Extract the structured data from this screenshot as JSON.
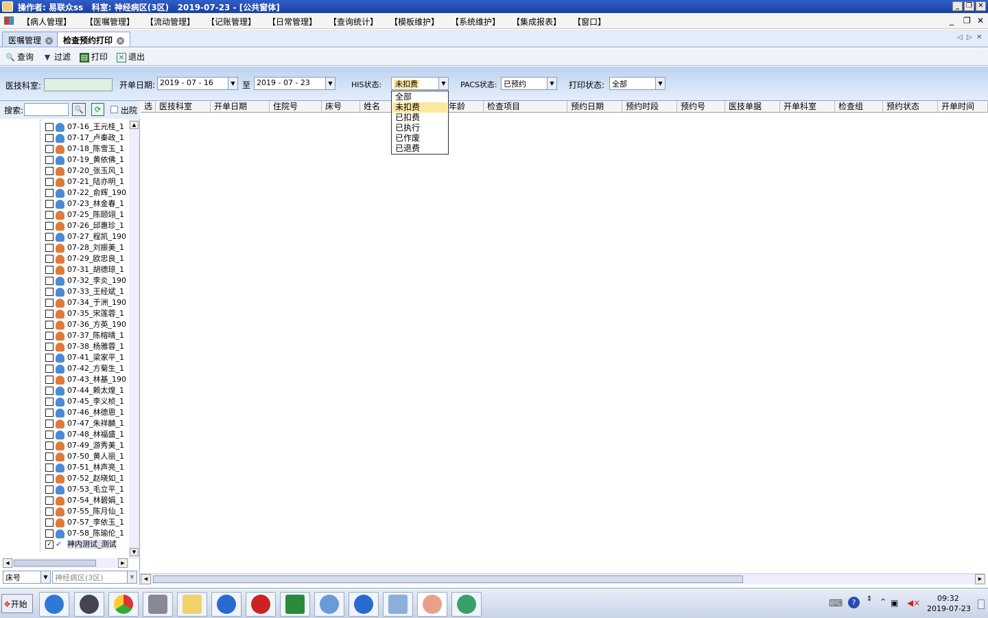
{
  "window": {
    "title": "操作者: 易联众ss   科室: 神经病区(3区)   2019-07-23 - [公共窗体]",
    "buttons": [
      "_",
      "❐",
      "✕"
    ]
  },
  "menu": {
    "items": [
      "【病人管理】",
      "【医嘱管理】",
      "【流动管理】",
      "【记账管理】",
      "【日常管理】",
      "【查询统计】",
      "【模板维护】",
      "【系统维护】",
      "【集成报表】",
      "【窗口】"
    ],
    "right_buttons": [
      "_",
      "❐",
      "✕"
    ]
  },
  "tabs": [
    {
      "label": "医嘱管理",
      "active": false
    },
    {
      "label": "检查预约打印",
      "active": true
    }
  ],
  "tab_nav": [
    "◁",
    "▷",
    "✕"
  ],
  "toolbar": {
    "query": "查询",
    "filter": "过滤",
    "print": "打印",
    "exit": "退出"
  },
  "filters": {
    "dept_label": "医技科室:",
    "dept_value": "",
    "start_label": "开单日期:",
    "start_value": "2019 - 07 - 16",
    "to_label": "至",
    "end_value": "2019 - 07 - 23",
    "his_label": "HIS状态:",
    "his_value": "未扣费",
    "pacs_label": "PACS状态:",
    "pacs_value": "已预约",
    "print_label": "打印状态:",
    "print_value": "全部"
  },
  "his_dropdown": {
    "options": [
      "全部",
      "未扣费",
      "已扣费",
      "已执行",
      "已作废",
      "已退费"
    ],
    "selected": "未扣费"
  },
  "search": {
    "label": "搜索:",
    "value": "",
    "discharge_label": "出院"
  },
  "patients": [
    {
      "label": "07-16_王元桂_1",
      "sex": "m"
    },
    {
      "label": "07-17_卢秦政_1",
      "sex": "m"
    },
    {
      "label": "07-18_陈雪玉_1",
      "sex": "f"
    },
    {
      "label": "07-19_黄依佛_1",
      "sex": "m"
    },
    {
      "label": "07-20_张玉风_1",
      "sex": "f"
    },
    {
      "label": "07-21_陆亦明_1",
      "sex": "f"
    },
    {
      "label": "07-22_俞辉_190",
      "sex": "m"
    },
    {
      "label": "07-23_林金春_1",
      "sex": "m"
    },
    {
      "label": "07-25_陈颐翊_1",
      "sex": "f"
    },
    {
      "label": "07-26_邱惠珍_1",
      "sex": "f"
    },
    {
      "label": "07-27_程凯_190",
      "sex": "m"
    },
    {
      "label": "07-28_刘振美_1",
      "sex": "f"
    },
    {
      "label": "07-29_欧忠良_1",
      "sex": "f"
    },
    {
      "label": "07-31_胡德琼_1",
      "sex": "f"
    },
    {
      "label": "07-32_李炎_190",
      "sex": "m"
    },
    {
      "label": "07-33_王经斌_1",
      "sex": "m"
    },
    {
      "label": "07-34_于洲_190",
      "sex": "f"
    },
    {
      "label": "07-35_宋莲蓉_1",
      "sex": "f"
    },
    {
      "label": "07-36_方英_190",
      "sex": "f"
    },
    {
      "label": "07-37_陈榕晴_1",
      "sex": "f"
    },
    {
      "label": "07-38_杨雅蓉_1",
      "sex": "f"
    },
    {
      "label": "07-41_梁家平_1",
      "sex": "m"
    },
    {
      "label": "07-42_方菊生_1",
      "sex": "m"
    },
    {
      "label": "07-43_林基_190",
      "sex": "f"
    },
    {
      "label": "07-44_赖太煌_1",
      "sex": "m"
    },
    {
      "label": "07-45_李义桢_1",
      "sex": "m"
    },
    {
      "label": "07-46_林德恩_1",
      "sex": "m"
    },
    {
      "label": "07-47_朱祥麟_1",
      "sex": "f"
    },
    {
      "label": "07-48_林福盛_1",
      "sex": "m"
    },
    {
      "label": "07-49_游秀美_1",
      "sex": "f"
    },
    {
      "label": "07-50_黄人丽_1",
      "sex": "f"
    },
    {
      "label": "07-51_林声亮_1",
      "sex": "m"
    },
    {
      "label": "07-52_赵晓如_1",
      "sex": "f"
    },
    {
      "label": "07-53_毛立平_1",
      "sex": "m"
    },
    {
      "label": "07-54_林碧娟_1",
      "sex": "f"
    },
    {
      "label": "07-55_陈月仙_1",
      "sex": "f"
    },
    {
      "label": "07-57_李依玉_1",
      "sex": "f"
    },
    {
      "label": "07-58_陈瑜伦_1",
      "sex": "m"
    },
    {
      "label": "神内测试_测试",
      "sex": "check"
    }
  ],
  "bottom_left": {
    "sort_value": "床号",
    "ward_value": "神经病区(3区)"
  },
  "grid_columns": [
    "选",
    "医技科室",
    "开单日期",
    "住院号",
    "床号",
    "姓名",
    "年龄",
    "检查项目",
    "预约日期",
    "预约时段",
    "预约号",
    "医技单据",
    "开单科室",
    "检查组",
    "预约状态",
    "开单时间"
  ],
  "taskbar": {
    "start_label": "开始",
    "time": "09:32",
    "date": "2019-07-23"
  },
  "colors": {
    "title_bar": "#1b3f9e",
    "dropdown_highlight": "#fde8a0",
    "filter_bg": "#bdd3f0"
  }
}
